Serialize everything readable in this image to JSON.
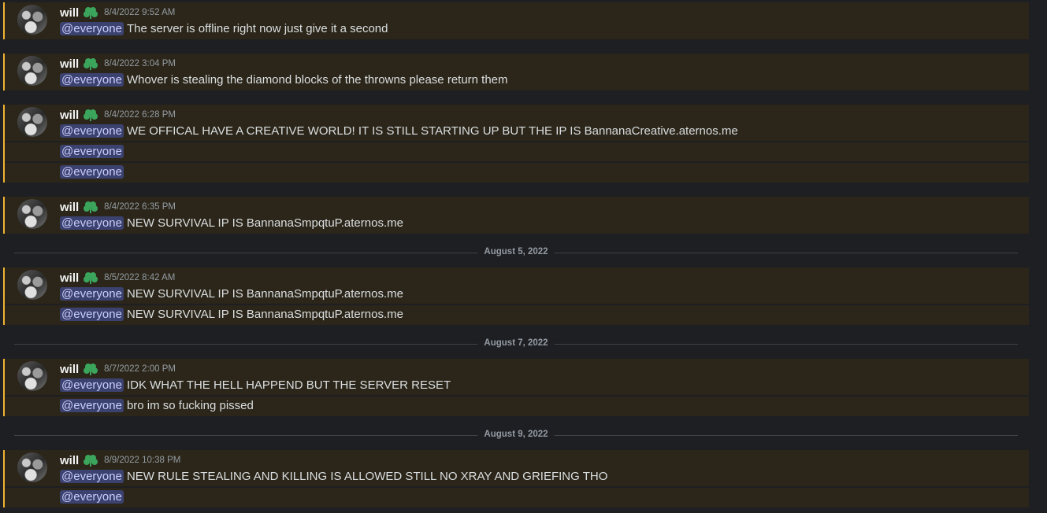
{
  "author": "will",
  "mention": "@everyone",
  "colors": {
    "background": "#1e1f22",
    "highlight_bg": "#2b2619",
    "highlight_border": "#f0b232",
    "mention_bg": "#3c4270",
    "mention_text": "#c9cdfb",
    "badge": "#3ba55c"
  },
  "groups": [
    {
      "timestamp": "8/4/2022 9:52 AM",
      "lines": [
        {
          "mention": "@everyone",
          "text": "The server is offline right now just give it a second"
        }
      ]
    },
    {
      "timestamp": "8/4/2022 3:04 PM",
      "lines": [
        {
          "mention": "@everyone",
          "text": "Whover is stealing the diamond blocks of the throwns please return them"
        }
      ]
    },
    {
      "timestamp": "8/4/2022 6:28 PM",
      "lines": [
        {
          "mention": "@everyone",
          "text": " WE OFFICAL HAVE A CREATIVE WORLD! IT IS STILL STARTING UP BUT THE IP IS BannanaCreative.aternos.me"
        },
        {
          "mention": "@everyone",
          "text": ""
        },
        {
          "mention": "@everyone",
          "text": ""
        }
      ]
    },
    {
      "timestamp": "8/4/2022 6:35 PM",
      "lines": [
        {
          "mention": "@everyone",
          "text": "NEW SURVIVAL IP IS BannanaSmpqtuP.aternos.me"
        }
      ]
    },
    {
      "timestamp": "8/5/2022 8:42 AM",
      "lines": [
        {
          "mention": "@everyone",
          "text": "NEW SURVIVAL IP IS BannanaSmpqtuP.aternos.me"
        },
        {
          "mention": "@everyone",
          "text": "NEW SURVIVAL IP IS BannanaSmpqtuP.aternos.me"
        }
      ]
    },
    {
      "timestamp": "8/7/2022 2:00 PM",
      "lines": [
        {
          "mention": "@everyone",
          "text": "IDK WHAT THE HELL HAPPEND BUT THE SERVER RESET"
        },
        {
          "mention": "@everyone",
          "text": "bro im so fucking pissed"
        }
      ]
    },
    {
      "timestamp": "8/9/2022 10:38 PM",
      "lines": [
        {
          "mention": "@everyone",
          "text": "NEW RULE STEALING AND KILLING IS ALLOWED STILL NO XRAY AND GRIEFING THO"
        },
        {
          "mention": "@everyone",
          "text": ""
        }
      ]
    }
  ],
  "dividers": [
    "August 5, 2022",
    "August 7, 2022",
    "August 9, 2022"
  ]
}
